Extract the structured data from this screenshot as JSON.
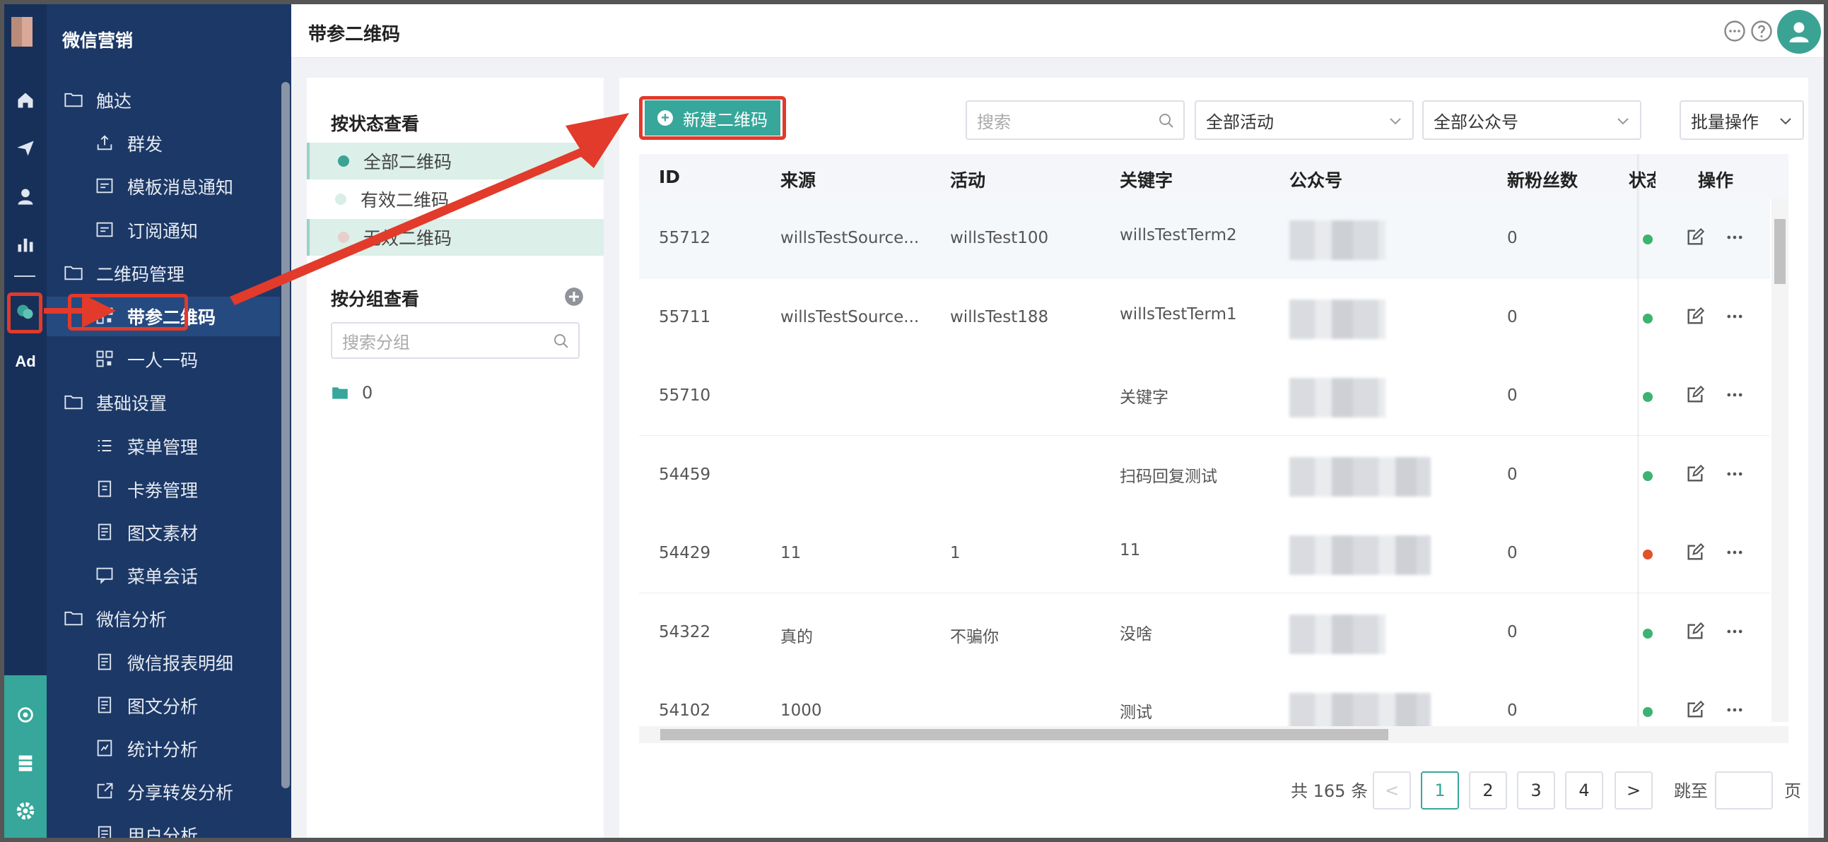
{
  "app": {
    "title": "微信营销"
  },
  "header": {
    "page_title": "带参二维码"
  },
  "menu": {
    "items": [
      {
        "label": "触达",
        "level": 1,
        "icon": "folder-icon"
      },
      {
        "label": "群发",
        "level": 2,
        "icon": "broadcast-icon"
      },
      {
        "label": "模板消息通知",
        "level": 2,
        "icon": "template-icon"
      },
      {
        "label": "订阅通知",
        "level": 2,
        "icon": "template-icon"
      },
      {
        "label": "二维码管理",
        "level": 1,
        "icon": "folder-icon"
      },
      {
        "label": "带参二维码",
        "level": 2,
        "icon": "qrcode-icon",
        "active": true
      },
      {
        "label": "一人一码",
        "level": 2,
        "icon": "qrcode-icon"
      },
      {
        "label": "基础设置",
        "level": 1,
        "icon": "folder-icon"
      },
      {
        "label": "菜单管理",
        "level": 2,
        "icon": "list-icon"
      },
      {
        "label": "卡劵管理",
        "level": 2,
        "icon": "card-icon"
      },
      {
        "label": "图文素材",
        "level": 2,
        "icon": "doc-icon"
      },
      {
        "label": "菜单会话",
        "level": 2,
        "icon": "chat-icon"
      },
      {
        "label": "微信分析",
        "level": 1,
        "icon": "folder-icon"
      },
      {
        "label": "微信报表明细",
        "level": 2,
        "icon": "doc-icon"
      },
      {
        "label": "图文分析",
        "level": 2,
        "icon": "doc-icon"
      },
      {
        "label": "统计分析",
        "level": 2,
        "icon": "stats-icon"
      },
      {
        "label": "分享转发分析",
        "level": 2,
        "icon": "share-icon"
      },
      {
        "label": "用户分析",
        "level": 2,
        "icon": "doc-icon"
      }
    ]
  },
  "rail": {
    "ad_label": "Ad"
  },
  "filter": {
    "status_title": "按状态查看",
    "status_items": [
      {
        "label": "全部二维码",
        "dot": "#3aa394"
      },
      {
        "label": "有效二维码",
        "dot": "#d8eee8"
      },
      {
        "label": "无效二维码",
        "dot": "#e8cfca"
      }
    ],
    "group_title": "按分组查看",
    "group_search_placeholder": "搜索分组",
    "groups": [
      {
        "label": "0"
      }
    ]
  },
  "toolbar": {
    "new_label": "新建二维码",
    "search_placeholder": "搜索",
    "activity_select": "全部活动",
    "account_select": "全部公众号",
    "batch_label": "批量操作"
  },
  "table": {
    "columns": [
      "ID",
      "来源",
      "活动",
      "关键字",
      "公众号",
      "新粉丝数",
      "状态",
      "操作"
    ],
    "rows": [
      {
        "id": "55712",
        "source": "willsTestSource...",
        "activity": "willsTest100",
        "keyword": "willsTestTerm2",
        "new_fans": "0",
        "status_color": "#3cb371"
      },
      {
        "id": "55711",
        "source": "willsTestSource...",
        "activity": "willsTest188",
        "keyword": "willsTestTerm1",
        "new_fans": "0",
        "status_color": "#3cb371"
      },
      {
        "id": "55710",
        "source": "",
        "activity": "",
        "keyword": "关键字",
        "new_fans": "0",
        "status_color": "#3cb371"
      },
      {
        "id": "54459",
        "source": "",
        "activity": "",
        "keyword": "扫码回复测试",
        "new_fans": "0",
        "status_color": "#3cb371"
      },
      {
        "id": "54429",
        "source": "11",
        "activity": "1",
        "keyword": "11",
        "new_fans": "0",
        "status_color": "#e0522a"
      },
      {
        "id": "54322",
        "source": "真的",
        "activity": "不骗你",
        "keyword": "没啥",
        "new_fans": "0",
        "status_color": "#3cb371"
      },
      {
        "id": "54102",
        "source": "1000",
        "activity": "",
        "keyword": "测试",
        "new_fans": "0",
        "status_color": "#3cb371"
      }
    ]
  },
  "pagination": {
    "total": "共 165 条",
    "pages": [
      "1",
      "2",
      "3",
      "4"
    ],
    "current": "1",
    "prev": "<",
    "next": ">",
    "jump_label": "跳至",
    "page_suffix": "页"
  },
  "colors": {
    "accent": "#36a79a",
    "sidebar": "#1c3866",
    "annotation": "#e23a2b"
  }
}
